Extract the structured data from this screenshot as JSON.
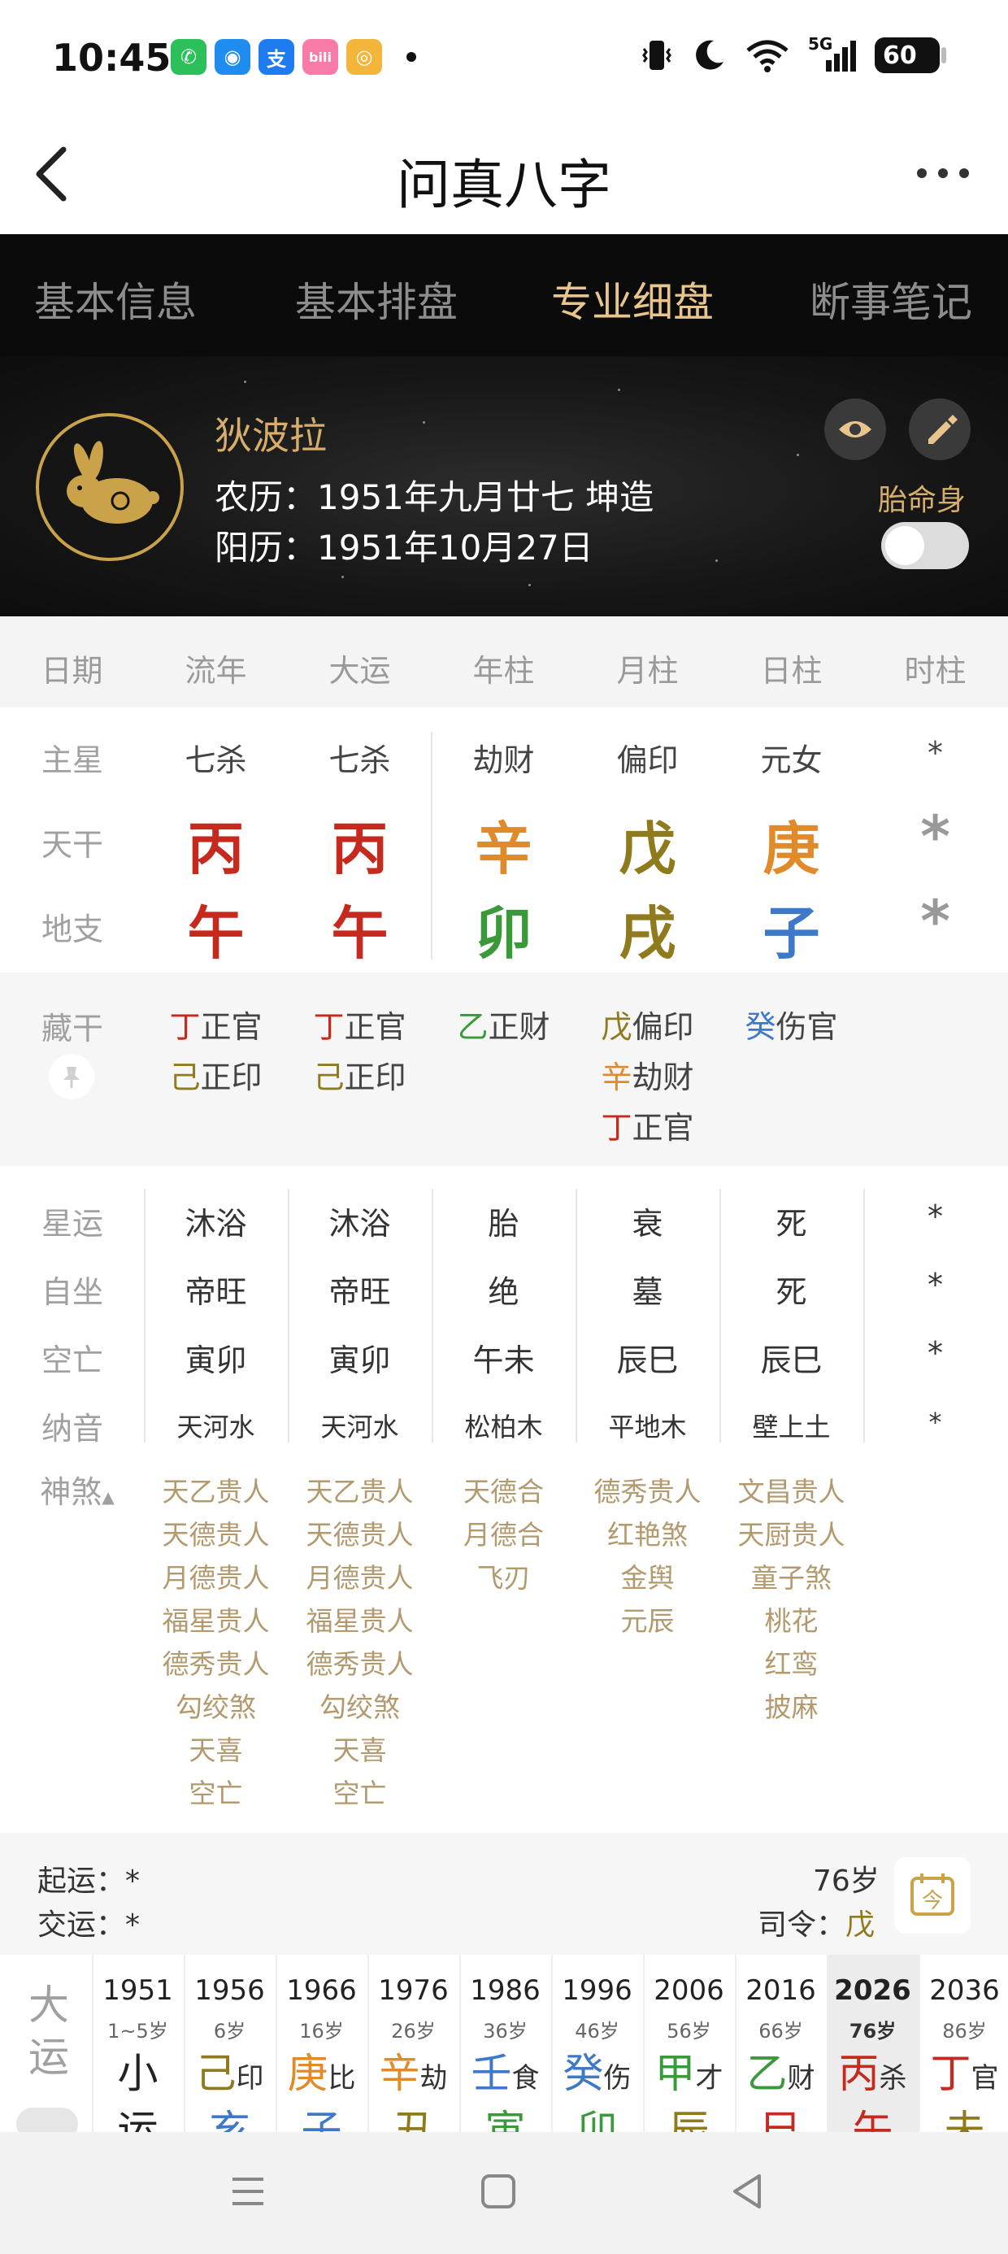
{
  "status_bar": {
    "time": "10:45",
    "apps": [
      {
        "icon": "wechat-icon",
        "glyph": "✆",
        "color": "#2bc05a"
      },
      {
        "icon": "qq-icon",
        "glyph": "◉",
        "color": "#1f8cf0"
      },
      {
        "icon": "alipay-icon",
        "glyph": "支",
        "color": "#1f7cf0"
      },
      {
        "icon": "bilibili-icon",
        "glyph": "bili",
        "color": "#f77aa9"
      },
      {
        "icon": "weibo-icon",
        "glyph": "◎",
        "color": "#f3b53a"
      }
    ],
    "signal_label": "5G",
    "battery": "60"
  },
  "header": {
    "title": "问真八字"
  },
  "tabs": [
    {
      "label": "基本信息",
      "active": false
    },
    {
      "label": "基本排盘",
      "active": false
    },
    {
      "label": "专业细盘",
      "active": true
    },
    {
      "label": "断事笔记",
      "active": false
    }
  ],
  "profile": {
    "name": "狄波拉",
    "lunar": "农历：1951年九月廿七 坤造",
    "solar": "阳历：1951年10月27日",
    "taiming_label": "胎命身",
    "toggle_on": false
  },
  "columns": [
    "日期",
    "流年",
    "大运",
    "年柱",
    "月柱",
    "日柱",
    "时柱"
  ],
  "colors": {
    "fire": "#c62a1e",
    "metal_orange": "#e08a2a",
    "wood": "#3a9a3a",
    "earth": "#8f7a1e",
    "water": "#3e78c8",
    "unknown": "#999999"
  },
  "grid": {
    "labels": {
      "zhuxing": "主星",
      "tiangan": "天干",
      "dizhi": "地支"
    },
    "zhuxing": [
      "七杀",
      "七杀",
      "劫财",
      "偏印",
      "元女",
      "*"
    ],
    "tiangan": [
      {
        "char": "丙",
        "color": "#c62a1e"
      },
      {
        "char": "丙",
        "color": "#c62a1e"
      },
      {
        "char": "辛",
        "color": "#e08a2a"
      },
      {
        "char": "戊",
        "color": "#8f7a1e"
      },
      {
        "char": "庚",
        "color": "#e08a2a"
      },
      {
        "char": "*",
        "color": "#999999"
      }
    ],
    "dizhi": [
      {
        "char": "午",
        "color": "#c62a1e"
      },
      {
        "char": "午",
        "color": "#c62a1e"
      },
      {
        "char": "卯",
        "color": "#3a9a3a"
      },
      {
        "char": "戌",
        "color": "#8f7a1e"
      },
      {
        "char": "子",
        "color": "#3e78c8"
      },
      {
        "char": "*",
        "color": "#999999"
      }
    ]
  },
  "canggan": {
    "label": "藏干",
    "columns": [
      [
        {
          "gan": "丁",
          "color": "#c62a1e",
          "shen": "正官"
        },
        {
          "gan": "己",
          "color": "#8f7a1e",
          "shen": "正印"
        }
      ],
      [
        {
          "gan": "丁",
          "color": "#c62a1e",
          "shen": "正官"
        },
        {
          "gan": "己",
          "color": "#8f7a1e",
          "shen": "正印"
        }
      ],
      [
        {
          "gan": "乙",
          "color": "#3a9a3a",
          "shen": "正财"
        }
      ],
      [
        {
          "gan": "戊",
          "color": "#8f7a1e",
          "shen": "偏印"
        },
        {
          "gan": "辛",
          "color": "#e08a2a",
          "shen": "劫财"
        },
        {
          "gan": "丁",
          "color": "#c62a1e",
          "shen": "正官"
        }
      ],
      [
        {
          "gan": "癸",
          "color": "#3e78c8",
          "shen": "伤官"
        }
      ],
      []
    ]
  },
  "details": {
    "labels": [
      "星运",
      "自坐",
      "空亡",
      "纳音"
    ],
    "rows": [
      [
        "沐浴",
        "沐浴",
        "胎",
        "衰",
        "死",
        "*"
      ],
      [
        "帝旺",
        "帝旺",
        "绝",
        "墓",
        "死",
        "*"
      ],
      [
        "寅卯",
        "寅卯",
        "午未",
        "辰巳",
        "辰巳",
        "*"
      ],
      [
        "天河水",
        "天河水",
        "松柏木",
        "平地木",
        "壁上土",
        "*"
      ]
    ]
  },
  "shensha": {
    "label": "神煞",
    "columns": [
      [
        "天乙贵人",
        "天德贵人",
        "月德贵人",
        "福星贵人",
        "德秀贵人",
        "勾绞煞",
        "天喜",
        "空亡"
      ],
      [
        "天乙贵人",
        "天德贵人",
        "月德贵人",
        "福星贵人",
        "德秀贵人",
        "勾绞煞",
        "天喜",
        "空亡"
      ],
      [
        "天德合",
        "月德合",
        "飞刃"
      ],
      [
        "德秀贵人",
        "红艳煞",
        "金舆",
        "元辰"
      ],
      [
        "文昌贵人",
        "天厨贵人",
        "童子煞",
        "桃花",
        "红鸾",
        "披麻"
      ],
      []
    ]
  },
  "qiyun": {
    "qiyun_label": "起运：",
    "qiyun_value": "*",
    "jiaoyun_label": "交运：",
    "jiaoyun_value": "*",
    "age": "76岁",
    "siling_label": "司令：",
    "siling_value": "戊",
    "siling_color": "#8f7a1e",
    "cal_glyph": "今"
  },
  "dayun": {
    "label_top": "大",
    "label_bottom": "运",
    "items": [
      {
        "year": "1951",
        "age": "1~5岁",
        "gan": "小",
        "gan_color": "#222222",
        "gan_shen": "",
        "zhi": "运",
        "zhi_color": "#222222",
        "highlight": false
      },
      {
        "year": "1956",
        "age": "6岁",
        "gan": "己",
        "gan_color": "#8f7a1e",
        "gan_shen": "印",
        "zhi": "亥",
        "zhi_color": "#3e78c8",
        "highlight": false
      },
      {
        "year": "1966",
        "age": "16岁",
        "gan": "庚",
        "gan_color": "#e08a2a",
        "gan_shen": "比",
        "zhi": "子",
        "zhi_color": "#3e78c8",
        "highlight": false
      },
      {
        "year": "1976",
        "age": "26岁",
        "gan": "辛",
        "gan_color": "#e08a2a",
        "gan_shen": "劫",
        "zhi": "丑",
        "zhi_color": "#8f7a1e",
        "highlight": false
      },
      {
        "year": "1986",
        "age": "36岁",
        "gan": "壬",
        "gan_color": "#3e78c8",
        "gan_shen": "食",
        "zhi": "寅",
        "zhi_color": "#3a9a3a",
        "highlight": false
      },
      {
        "year": "1996",
        "age": "46岁",
        "gan": "癸",
        "gan_color": "#3e78c8",
        "gan_shen": "伤",
        "zhi": "卯",
        "zhi_color": "#3a9a3a",
        "highlight": false
      },
      {
        "year": "2006",
        "age": "56岁",
        "gan": "甲",
        "gan_color": "#3a9a3a",
        "gan_shen": "才",
        "zhi": "辰",
        "zhi_color": "#8f7a1e",
        "highlight": false
      },
      {
        "year": "2016",
        "age": "66岁",
        "gan": "乙",
        "gan_color": "#3a9a3a",
        "gan_shen": "财",
        "zhi": "巳",
        "zhi_color": "#c62a1e",
        "highlight": false
      },
      {
        "year": "2026",
        "age": "76岁",
        "gan": "丙",
        "gan_color": "#c62a1e",
        "gan_shen": "杀",
        "zhi": "午",
        "zhi_color": "#c62a1e",
        "highlight": true
      },
      {
        "year": "2036",
        "age": "86岁",
        "gan": "丁",
        "gan_color": "#c62a1e",
        "gan_shen": "官",
        "zhi": "未",
        "zhi_color": "#8f7a1e",
        "highlight": false
      }
    ]
  }
}
